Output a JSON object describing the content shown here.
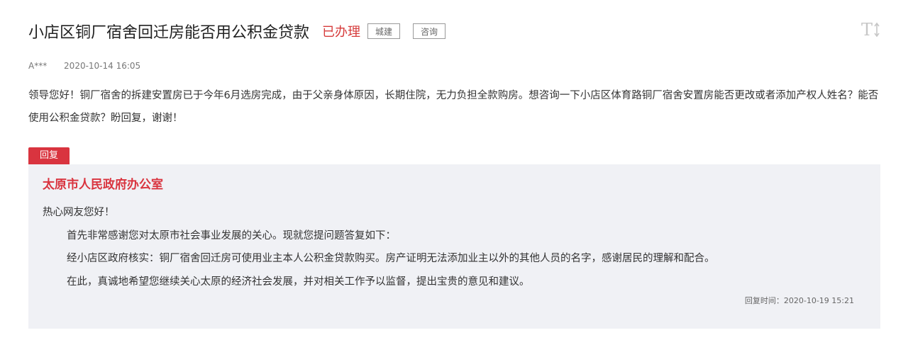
{
  "header": {
    "title": "小店区铜厂宿舍回迁房能否用公积金贷款",
    "status": "已办理",
    "tags": [
      "城建",
      "咨询"
    ],
    "font_toggle_label": "T"
  },
  "meta": {
    "author": "A***",
    "date": "2020-10-14 16:05"
  },
  "question": {
    "text": "领导您好！铜厂宿舍的拆建安置房已于今年6月选房完成，由于父亲身体原因，长期住院，无力负担全款购房。想咨询一下小店区体育路铜厂宿舍安置房能否更改或者添加产权人姓名？能否使用公积金贷款？盼回复，谢谢！"
  },
  "reply": {
    "badge": "回复",
    "org": "太原市人民政府办公室",
    "greeting": "热心网友您好！",
    "paragraphs": [
      "首先非常感谢您对太原市社会事业发展的关心。现就您提问题答复如下：",
      "经小店区政府核实：铜厂宿舍回迁房可使用业主本人公积金贷款购买。房产证明无法添加业主以外的其他人员的名字，感谢居民的理解和配合。",
      "在此，真诚地希望您继续关心太原的经济社会发展，并对相关工作予以监督，提出宝贵的意见和建议。"
    ],
    "time": "回复时间：2020-10-19 15:21"
  },
  "colors": {
    "accent_red": "#d9343f",
    "reply_bg": "#f0f1f5"
  }
}
